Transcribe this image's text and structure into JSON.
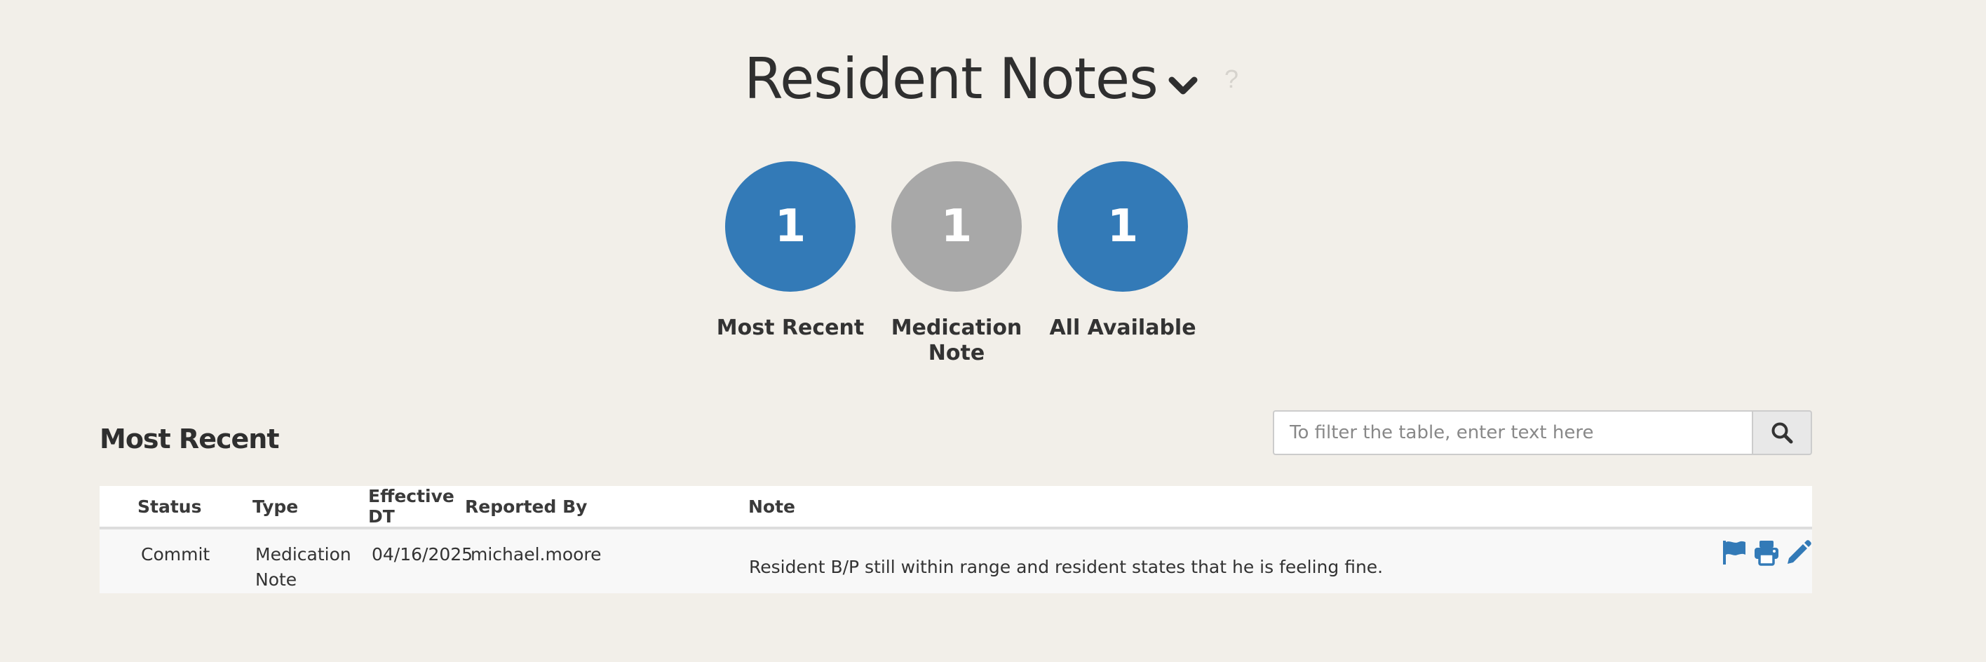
{
  "header": {
    "title": "Resident Notes",
    "help_label": "?"
  },
  "summary": [
    {
      "count": "1",
      "label": "Most Recent",
      "color": "#337ab7"
    },
    {
      "count": "1",
      "label": "Medication Note",
      "color": "#a8a8a8"
    },
    {
      "count": "1",
      "label": "All Available",
      "color": "#337ab7"
    }
  ],
  "section": {
    "title": "Most Recent"
  },
  "filter": {
    "placeholder": "To filter the table, enter text here",
    "value": ""
  },
  "table": {
    "columns": [
      "Status",
      "Type",
      "Effective DT",
      "Reported By",
      "Note"
    ],
    "rows": [
      {
        "status": "Commit",
        "type": "Medication Note",
        "effective_dt": "04/16/2025",
        "reported_by": "michael.moore",
        "note": "Resident B/P still within range and resident states that he is feeling fine.",
        "actions": [
          "flag-icon",
          "print-icon",
          "edit-icon"
        ]
      }
    ]
  },
  "colors": {
    "accent": "#337ab7",
    "muted": "#a8a8a8",
    "background": "#f2efe9"
  }
}
